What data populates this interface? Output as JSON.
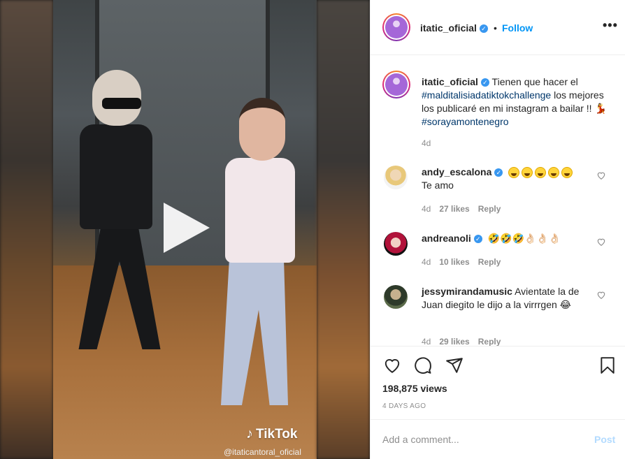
{
  "header": {
    "username": "itatic_oficial",
    "verified_icon": "verified-badge-icon",
    "dot": "•",
    "follow_label": "Follow",
    "more_icon": "more-options-icon",
    "more_text": "•••"
  },
  "video": {
    "play_icon": "play-icon",
    "watermark_brand": "TikTok",
    "watermark_handle": "@itaticantoral_oficial"
  },
  "caption": {
    "username": "itatic_oficial",
    "text_1": " Tienen que hacer el ",
    "hashtag_1": "#malditalisiadatiktokchallenge",
    "text_2": " los mejores los publicaré en mi instagram a bailar !! 💃 ",
    "hashtag_2": "#sorayamontenegro",
    "time": "4d"
  },
  "comments": [
    {
      "username": "andy_escalona",
      "verified": true,
      "text_line1_emojis": 5,
      "text": "Te amo",
      "time": "4d",
      "likes": "27 likes",
      "reply": "Reply"
    },
    {
      "username": "andreanoli",
      "verified": true,
      "text": "🤣🤣🤣👌🏻👌🏻👌🏻",
      "time": "4d",
      "likes": "10 likes",
      "reply": "Reply"
    },
    {
      "username": "jessymirandamusic",
      "verified": false,
      "text": " Avientate la de Juan diegito le dijo a la virrrgen 😂",
      "time": "4d",
      "likes": "29 likes",
      "reply": "Reply"
    }
  ],
  "actions": {
    "like_icon": "heart-icon",
    "comment_icon": "comment-icon",
    "share_icon": "share-icon",
    "save_icon": "bookmark-icon",
    "views": "198,875 views",
    "date": "4 DAYS AGO"
  },
  "add_comment": {
    "placeholder": "Add a comment...",
    "post_label": "Post"
  },
  "colors": {
    "accent": "#0095f6",
    "verified": "#3897f0",
    "text": "#262626",
    "muted": "#8e8e8e",
    "post_disabled": "#b3dbff"
  }
}
